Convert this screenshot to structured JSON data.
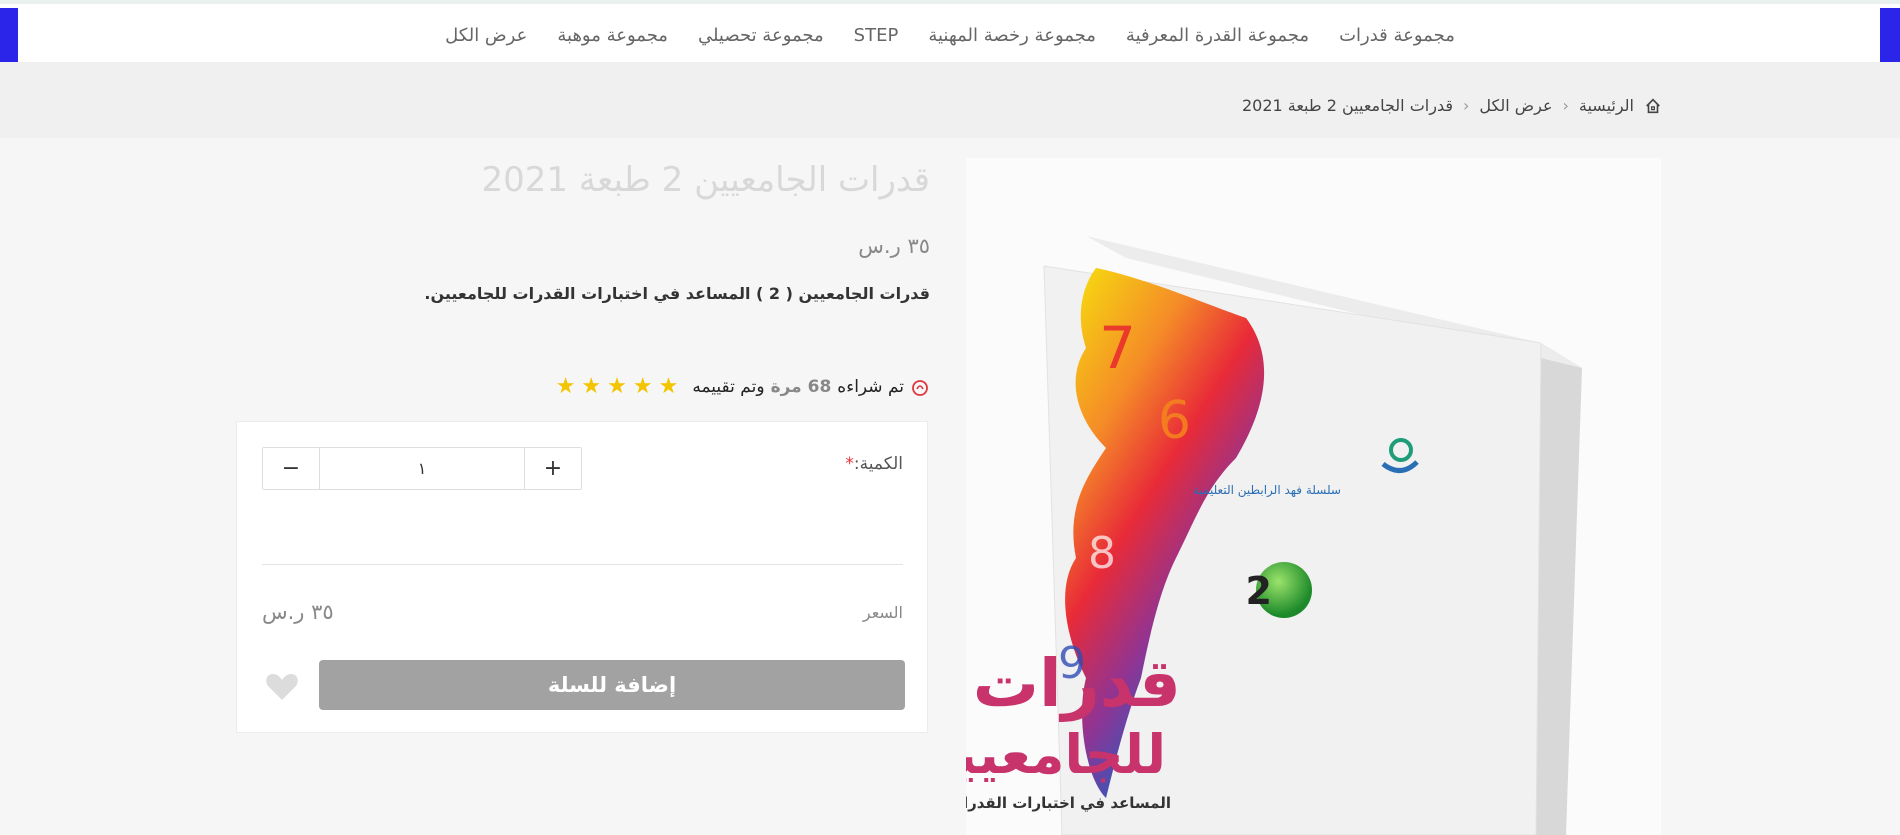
{
  "nav": {
    "items": [
      {
        "label": "مجموعة قدرات"
      },
      {
        "label": "مجموعة القدرة المعرفية"
      },
      {
        "label": "مجموعة رخصة المهنية"
      },
      {
        "label": "STEP"
      },
      {
        "label": "مجموعة تحصيلي"
      },
      {
        "label": "مجموعة موهبة"
      },
      {
        "label": "عرض الكل"
      }
    ]
  },
  "breadcrumb": {
    "home": "الرئيسية",
    "all": "عرض الكل",
    "current": "قدرات الجامعيين 2 طبعة 2021"
  },
  "product": {
    "title": "قدرات الجامعيين 2 طبعة 2021",
    "price": "٣٥ ر.س",
    "description": "قدرات الجامعيين ( 2 ) المساعد في اختبارات القدرات للجامعيين.",
    "purchase_prefix": "تم شراءه",
    "purchase_count": "68 مرة",
    "purchase_suffix": "وتم تقييمه",
    "rating_stars": 5,
    "image_alt": "قدرات للجامعيين",
    "cover": {
      "publisher": "سلسلة فهد الرابطين التعليمية",
      "number": "2",
      "title_line1": "قدرات",
      "title_line2": "للجامعيين",
      "subtitle": "المساعد في اختبارات القدرات للجامعيين"
    }
  },
  "cart": {
    "qty_label": "الكمية:",
    "qty_required": "*",
    "qty_value": "١",
    "plus": "+",
    "minus": "−",
    "total_label": "السعر",
    "total_value": "٣٥ ر.س",
    "add_label": "إضافة للسلة"
  },
  "colors": {
    "accent_edge": "#2a25e8",
    "button_bg": "#a2a2a2",
    "star": "#f3c400"
  }
}
